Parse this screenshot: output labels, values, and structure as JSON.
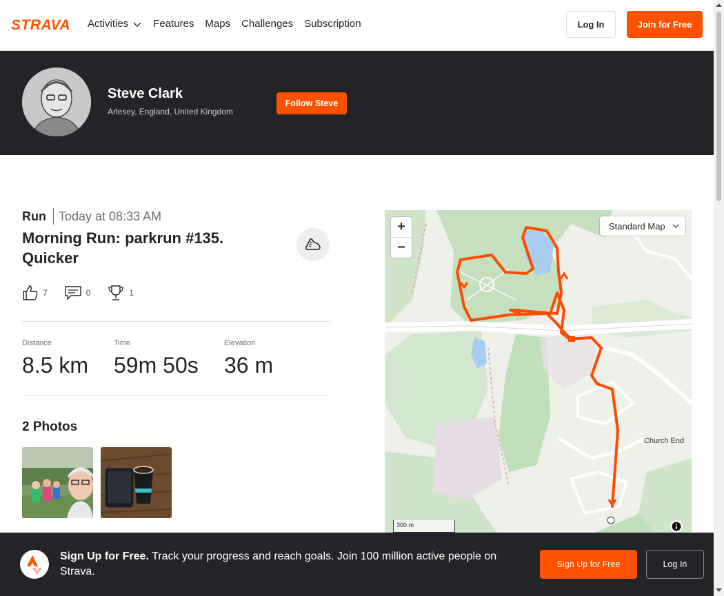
{
  "nav": {
    "brand": "STRAVA",
    "items": [
      {
        "label": "Activities",
        "has_dropdown": true
      },
      {
        "label": "Features"
      },
      {
        "label": "Maps"
      },
      {
        "label": "Challenges"
      },
      {
        "label": "Subscription"
      }
    ],
    "login_label": "Log In",
    "join_label": "Join for Free"
  },
  "athlete": {
    "name": "Steve Clark",
    "location": "Arlesey, England, United Kingdom",
    "follow_label": "Follow Steve"
  },
  "activity": {
    "sport": "Run",
    "time": "Today at 08:33 AM",
    "title": "Morning Run: parkrun #135. Quicker",
    "kudos": "7",
    "comments": "0",
    "achievements": "1",
    "stats": [
      {
        "label": "Distance",
        "value": "8.5 km"
      },
      {
        "label": "Time",
        "value": "59m 50s"
      },
      {
        "label": "Elevation",
        "value": "36 m"
      }
    ],
    "photos_title": "2 Photos"
  },
  "map": {
    "zoom_in": "+",
    "zoom_out": "−",
    "style_select": "Standard Map",
    "place_label": "Church End",
    "scale": "300 m"
  },
  "banner": {
    "headline": "Sign Up for Free.",
    "text": "Track your progress and reach goals. Join 100 million active people on Strava.",
    "signup_label": "Sign Up for Free",
    "login_label": "Log In"
  },
  "colors": {
    "brand_orange": "#fc5200",
    "dark_band": "#242428"
  }
}
